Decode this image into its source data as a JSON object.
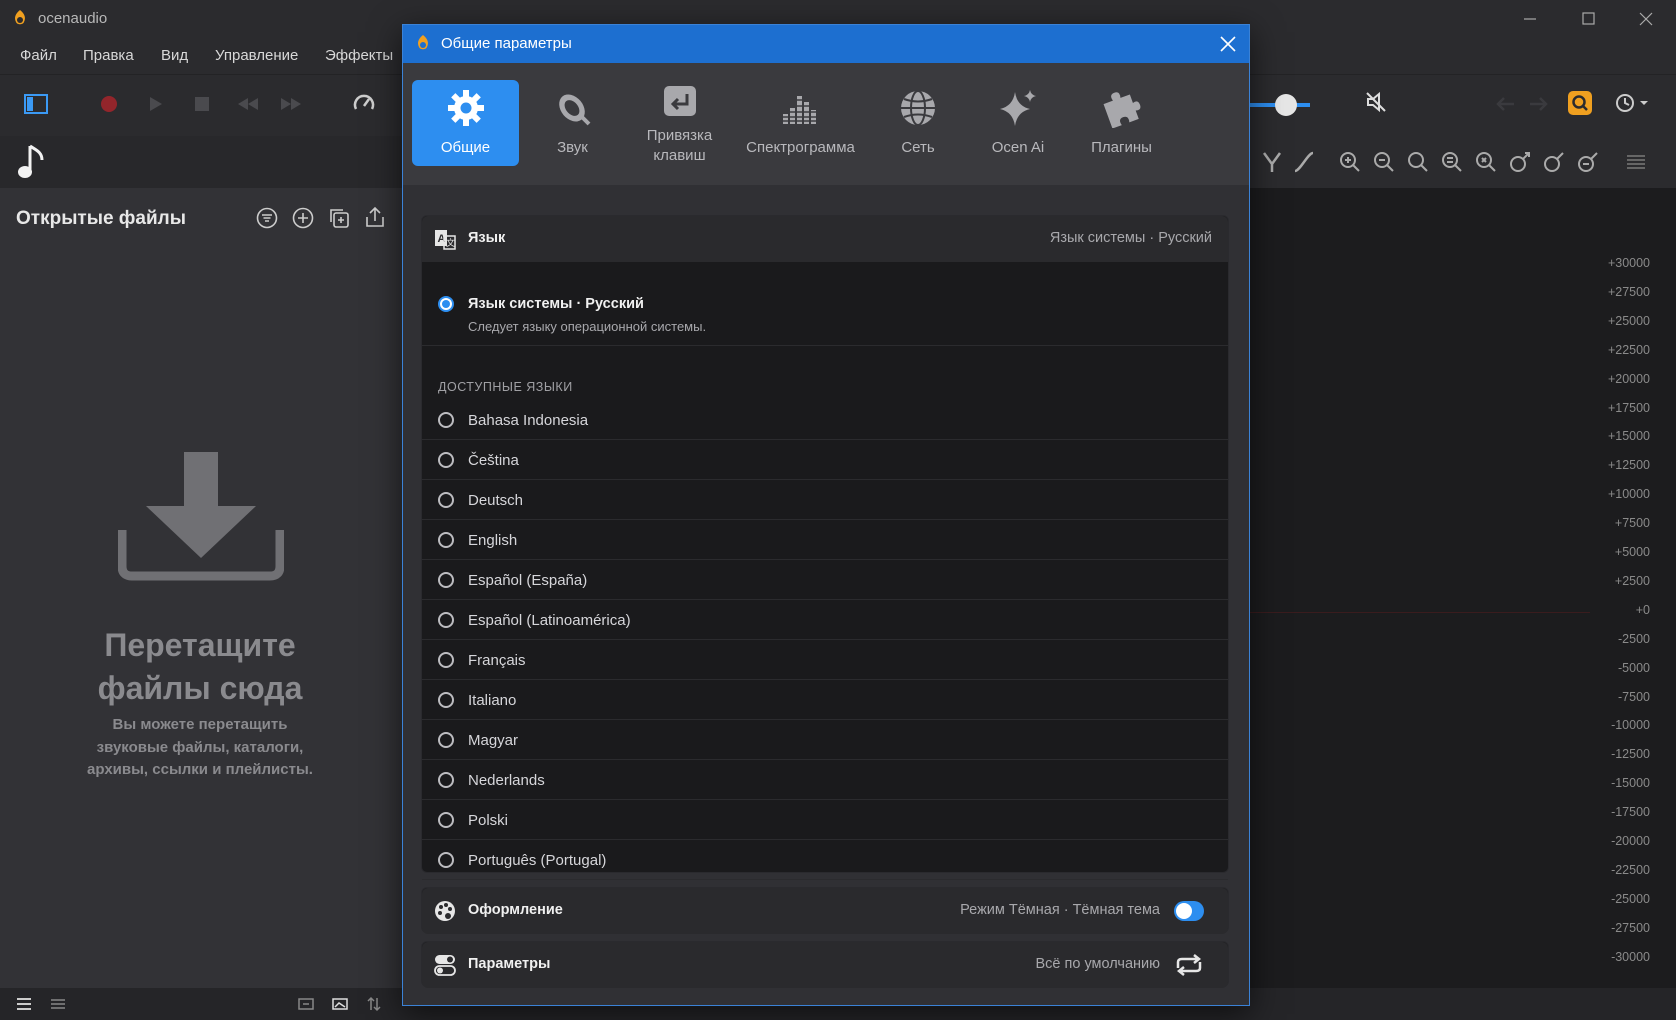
{
  "window": {
    "title": "ocenaudio"
  },
  "menu": [
    "Файл",
    "Правка",
    "Вид",
    "Управление",
    "Эффекты"
  ],
  "left_panel": {
    "heading": "Открытые файлы",
    "drop_title": "Перетащите файлы сюда",
    "drop_subtitle": "Вы можете перетащить звуковые файлы, каталоги, архивы, ссылки и плейлисты."
  },
  "y_axis_ticks": [
    "+30000",
    "+27500",
    "+25000",
    "+22500",
    "+20000",
    "+17500",
    "+15000",
    "+12500",
    "+10000",
    "+7500",
    "+5000",
    "+2500",
    "+0",
    "-2500",
    "-5000",
    "-7500",
    "-10000",
    "-12500",
    "-15000",
    "-17500",
    "-20000",
    "-22500",
    "-25000",
    "-27500",
    "-30000"
  ],
  "dialog": {
    "title": "Общие параметры",
    "tabs": [
      {
        "label": "Общие",
        "icon": "gear-icon",
        "active": true
      },
      {
        "label": "Звук",
        "icon": "speaker-icon"
      },
      {
        "label": "Привязка клавиш",
        "icon": "keyboard-enter-icon"
      },
      {
        "label": "Спектрограмма",
        "icon": "spectrogram-icon"
      },
      {
        "label": "Сеть",
        "icon": "globe-icon"
      },
      {
        "label": "Ocen Ai",
        "icon": "sparkle-icon"
      },
      {
        "label": "Плагины",
        "icon": "puzzle-icon"
      }
    ],
    "language": {
      "title": "Язык",
      "current": "Язык системы · Русский",
      "system_option": {
        "label": "Язык системы · Русский",
        "description": "Следует языку операционной системы.",
        "selected": true
      },
      "available_label": "ДОСТУПНЫЕ ЯЗЫКИ",
      "languages": [
        "Bahasa Indonesia",
        "Čeština",
        "Deutsch",
        "English",
        "Español (España)",
        "Español (Latinoamérica)",
        "Français",
        "Italiano",
        "Magyar",
        "Nederlands",
        "Polski",
        "Português (Portugal)"
      ]
    },
    "appearance": {
      "title": "Оформление",
      "value": "Режим Тёмная · Тёмная тема",
      "toggle_on": true
    },
    "parameters": {
      "title": "Параметры",
      "value": "Всё по умолчанию"
    }
  },
  "colors": {
    "accent": "#2d8ef0",
    "title_bar": "#1d6fd0",
    "record": "#c0242b",
    "search_highlight": "#f0a020"
  }
}
